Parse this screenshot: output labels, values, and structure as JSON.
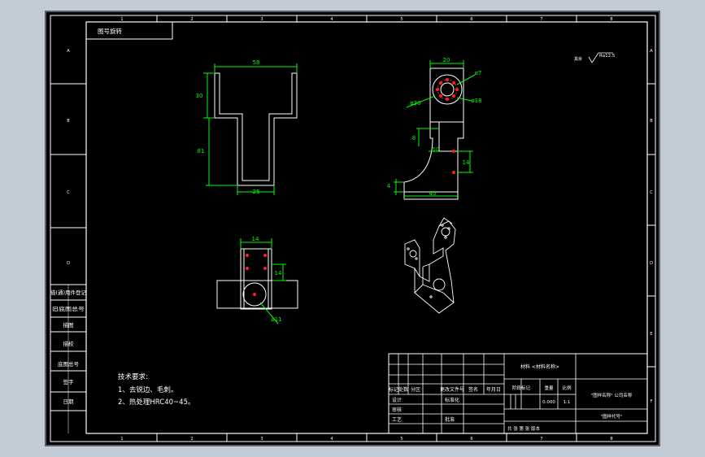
{
  "colors": {
    "background": "#c2ccd6",
    "paper": "#000000",
    "line": "#ffffff",
    "dimension": "#00ff00",
    "center_mark": "#ff2020"
  },
  "border": {
    "top_zones": [
      "1",
      "2",
      "3",
      "4",
      "5",
      "6",
      "7",
      "8"
    ],
    "bottom_zones": [
      "1",
      "2",
      "3",
      "4",
      "5",
      "6",
      "7",
      "8"
    ],
    "left_zones": [
      "A",
      "B",
      "C",
      "D"
    ],
    "right_zones": [
      "A",
      "B",
      "C",
      "D",
      "E",
      "F"
    ]
  },
  "doc_number_box": "图号旋转",
  "left_strip": [
    "借(通)用件登记",
    "旧底图总号",
    "描图",
    "描校",
    "底图总号",
    "签字",
    "日期"
  ],
  "roughness": {
    "prefix": "其余",
    "value": "Ra12.5"
  },
  "dimensions": {
    "front_top_width": "58",
    "front_upper_height": "30",
    "front_total_height": "81",
    "front_bottom_width": "25",
    "side_width": "20",
    "side_hole_small": "ø7",
    "side_hole_large": "ø30",
    "side_hole_right": "ø18",
    "side_slot_height": "8",
    "side_slot_depth": "10",
    "side_right_height": "14",
    "side_base_thick": "4",
    "side_base_width": "40",
    "top_width": "14",
    "top_height": "14",
    "top_hole": "ø11"
  },
  "tech_notes": {
    "title": "技术要求:",
    "items": [
      "1、去锐边、毛刺。",
      "2、热处理HRC40~45。"
    ]
  },
  "title_block": {
    "material": "材料 <材料名称>",
    "revision_headers": [
      "标记",
      "处数",
      "分区",
      "更改文件号",
      "签名",
      "年月日"
    ],
    "signatures": [
      "设计",
      "标准化",
      "审核",
      "工艺",
      "批准"
    ],
    "stage_headers": [
      "阶段标记",
      "重量",
      "比例"
    ],
    "weight": "0.000",
    "scale": "1:1",
    "company": "\"图样名称\" 公司名称",
    "drawing_no": "\"图样代号\"",
    "sheet_info": "共 张 第 张 版本"
  }
}
